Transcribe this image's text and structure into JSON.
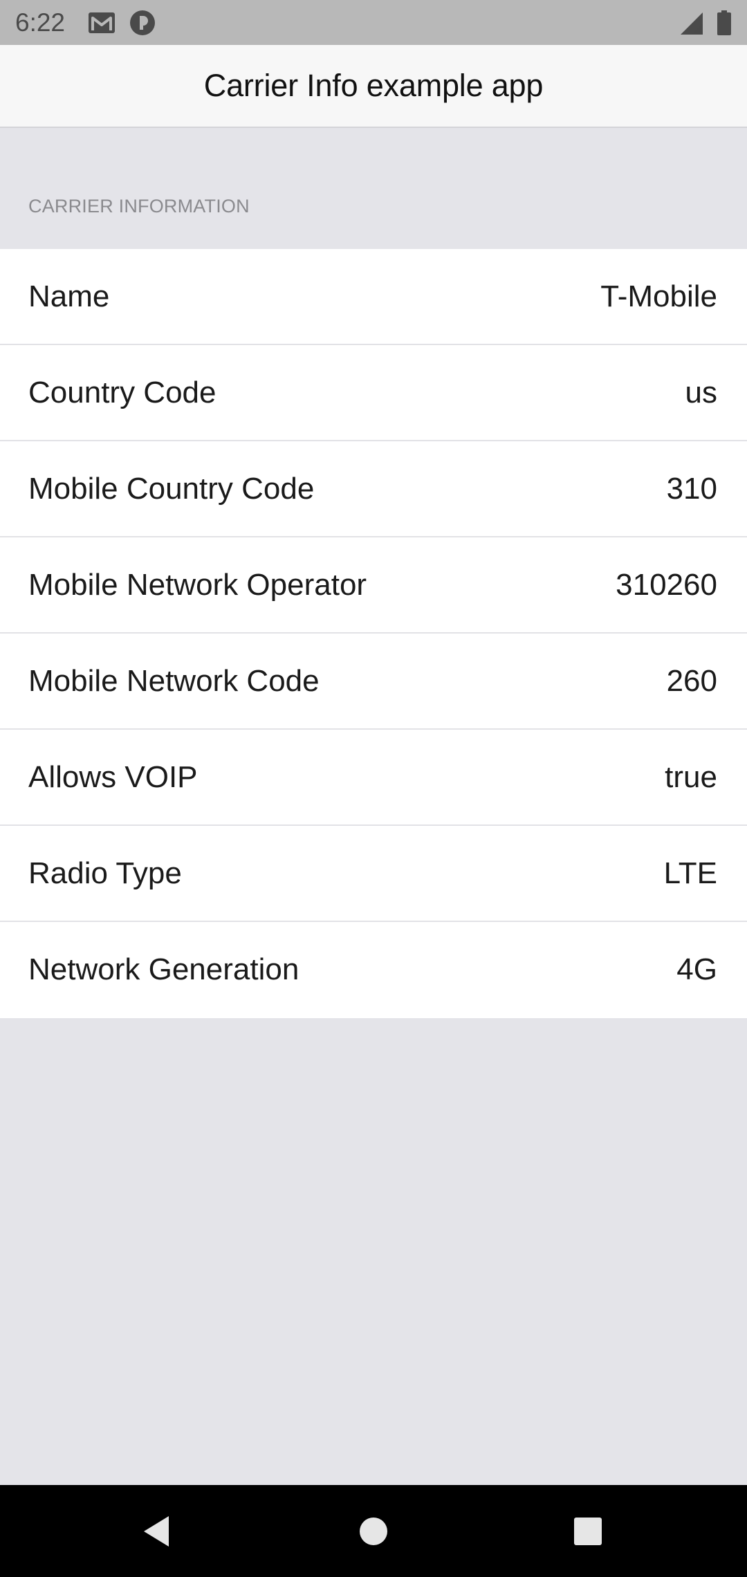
{
  "status_bar": {
    "time": "6:22",
    "left_icons": [
      "gmail-icon",
      "notification-icon"
    ],
    "right_icons": [
      "cell-signal-icon",
      "battery-icon"
    ]
  },
  "header": {
    "title": "Carrier Info example app"
  },
  "section": {
    "title": "CARRIER INFORMATION",
    "rows": [
      {
        "label": "Name",
        "value": "T-Mobile"
      },
      {
        "label": "Country Code",
        "value": "us"
      },
      {
        "label": "Mobile Country Code",
        "value": "310"
      },
      {
        "label": "Mobile Network Operator",
        "value": "310260"
      },
      {
        "label": "Mobile Network Code",
        "value": "260"
      },
      {
        "label": "Allows VOIP",
        "value": "true"
      },
      {
        "label": "Radio Type",
        "value": "LTE"
      },
      {
        "label": "Network Generation",
        "value": "4G"
      }
    ]
  },
  "nav_bar": {
    "buttons": [
      "back-icon",
      "home-icon",
      "recents-icon"
    ]
  },
  "colors": {
    "status_bar_bg": "#b8b8b8",
    "header_bg": "#f7f7f7",
    "page_bg": "#e4e4e9",
    "row_bg": "#ffffff",
    "section_header_text": "#8a8a8e",
    "nav_bar_bg": "#000000"
  }
}
